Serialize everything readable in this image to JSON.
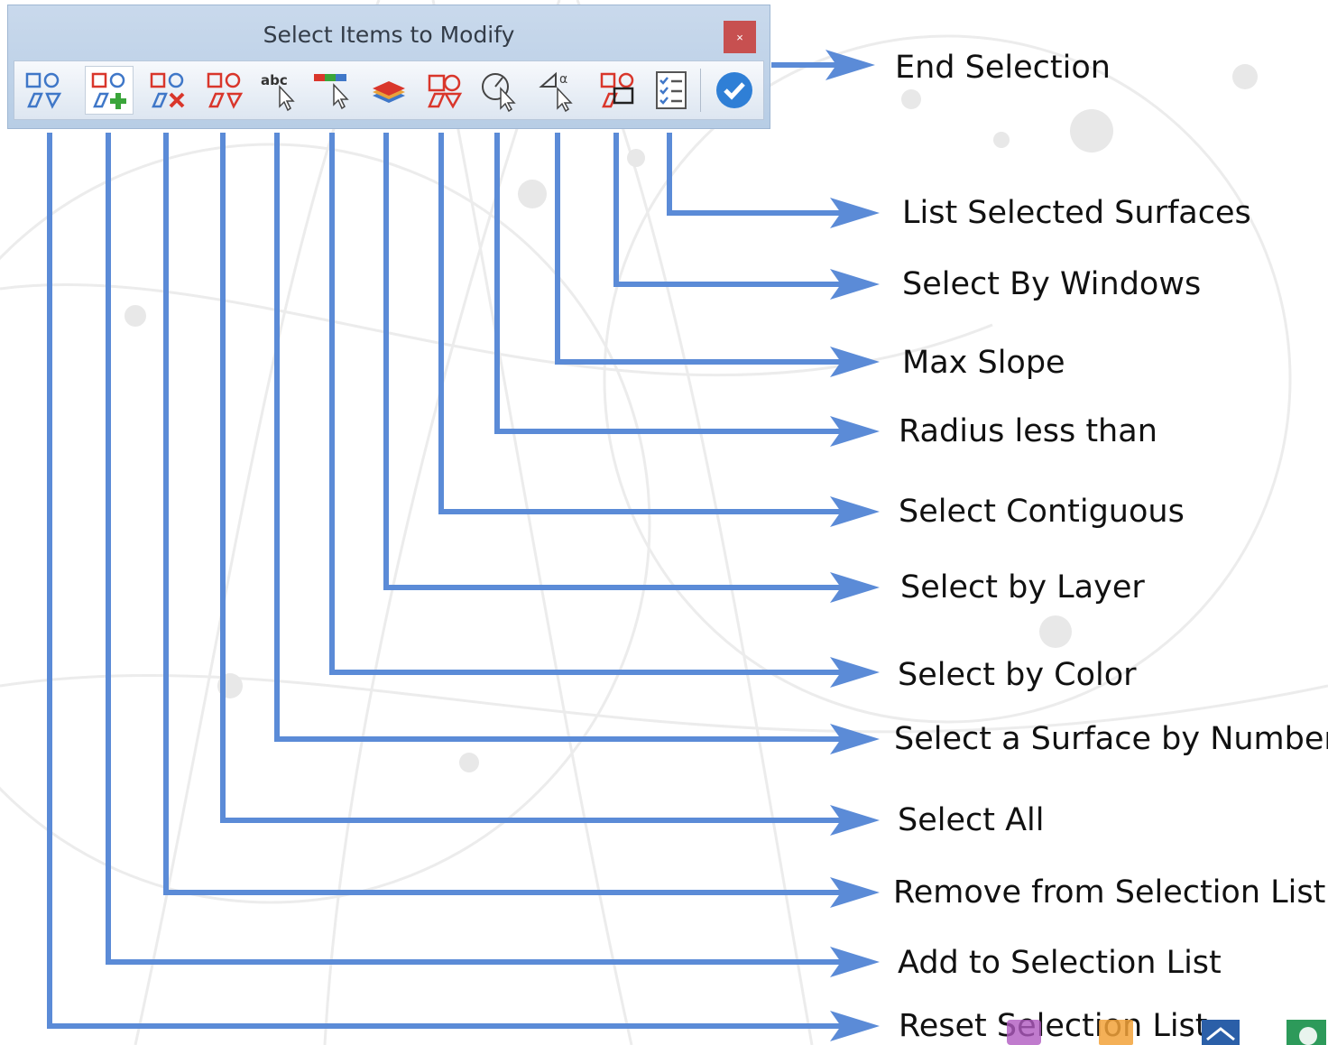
{
  "toolbar": {
    "title": "Select Items to Modify",
    "close_label": "×",
    "tools": [
      {
        "name": "reset-selection-list",
        "icon": "shapes-icon",
        "active": false
      },
      {
        "name": "add-to-selection-list",
        "icon": "shapes-add-icon",
        "active": true
      },
      {
        "name": "remove-from-selection-list",
        "icon": "shapes-remove-icon",
        "active": false
      },
      {
        "name": "select-all",
        "icon": "shapes-all-icon",
        "active": false
      },
      {
        "name": "select-surface-by-number",
        "icon": "abc-cursor-icon",
        "active": false
      },
      {
        "name": "select-by-color",
        "icon": "color-cursor-icon",
        "active": false
      },
      {
        "name": "select-by-layer",
        "icon": "layers-icon",
        "active": false
      },
      {
        "name": "select-contiguous",
        "icon": "contiguous-icon",
        "active": false
      },
      {
        "name": "radius-less-than",
        "icon": "radius-cursor-icon",
        "active": false
      },
      {
        "name": "max-slope",
        "icon": "slope-cursor-icon",
        "active": false
      },
      {
        "name": "select-by-windows",
        "icon": "window-select-icon",
        "active": false
      },
      {
        "name": "list-selected-surfaces",
        "icon": "checklist-icon",
        "active": false
      },
      {
        "name": "end-selection",
        "icon": "checkmark-icon",
        "active": false
      }
    ]
  },
  "callouts": [
    {
      "label": "End Selection"
    },
    {
      "label": "List Selected Surfaces"
    },
    {
      "label": "Select By Windows"
    },
    {
      "label": "Max Slope"
    },
    {
      "label": "Radius less than"
    },
    {
      "label": "Select Contiguous"
    },
    {
      "label": "Select by Layer"
    },
    {
      "label": "Select by Color"
    },
    {
      "label": "Select a Surface by Number"
    },
    {
      "label": "Select All"
    },
    {
      "label": "Remove from Selection List"
    },
    {
      "label": "Add to Selection List"
    },
    {
      "label": "Reset Selection List"
    }
  ],
  "colors": {
    "connector": "#5b8bd7",
    "icon_red": "#d9362b",
    "icon_blue": "#3f77c8",
    "icon_green": "#3aa53a",
    "window_bg": "#c3d5ea"
  }
}
